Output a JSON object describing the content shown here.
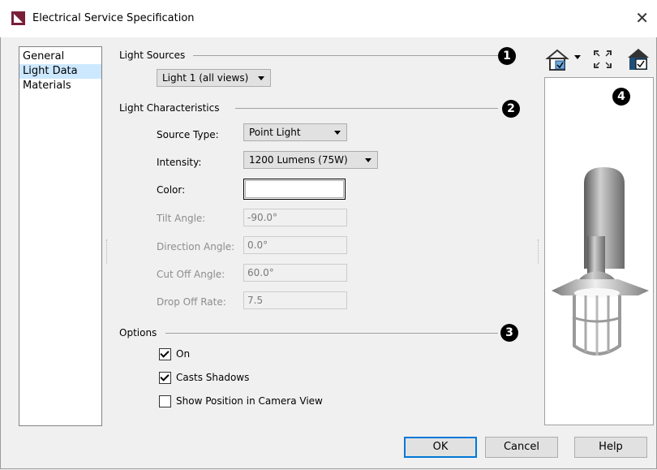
{
  "window": {
    "title": "Electrical Service Specification"
  },
  "sidebar": {
    "items": [
      {
        "label": "General"
      },
      {
        "label": "Light Data"
      },
      {
        "label": "Materials"
      }
    ]
  },
  "light_sources": {
    "heading": "Light Sources",
    "marker": "1",
    "selected": "Light 1 (all views)"
  },
  "light_characteristics": {
    "heading": "Light Characteristics",
    "marker": "2",
    "source_type": {
      "label": "Source Type:",
      "value": "Point Light"
    },
    "intensity": {
      "label": "Intensity:",
      "value": "1200 Lumens (75W)"
    },
    "color": {
      "label": "Color:",
      "value": "#ffffff"
    },
    "tilt_angle": {
      "label": "Tilt Angle:",
      "value": "-90.0°"
    },
    "direction_angle": {
      "label": "Direction Angle:",
      "value": "0.0°"
    },
    "cut_off_angle": {
      "label": "Cut Off Angle:",
      "value": "60.0°"
    },
    "drop_off_rate": {
      "label": "Drop Off Rate:",
      "value": "7.5"
    }
  },
  "options": {
    "heading": "Options",
    "marker": "3",
    "on": {
      "label": "On",
      "checked": true
    },
    "casts_shadows": {
      "label": "Casts Shadows",
      "checked": true
    },
    "show_position": {
      "label": "Show Position in Camera View",
      "checked": false
    }
  },
  "preview": {
    "marker": "4"
  },
  "buttons": {
    "ok": "OK",
    "cancel": "Cancel",
    "help": "Help"
  }
}
